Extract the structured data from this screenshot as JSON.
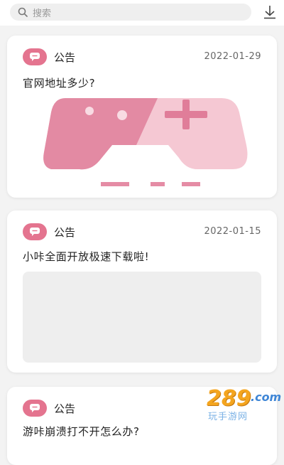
{
  "search": {
    "placeholder": "搜索",
    "icon": "search-icon"
  },
  "header": {
    "download_icon": "download-icon"
  },
  "colors": {
    "accent": "#e4748f",
    "image_pink": "#e8a1b4",
    "image_light": "#f4c6d2"
  },
  "notices": [
    {
      "badge": "公告",
      "date": "2022-01-29",
      "title": "官网地址多少?"
    },
    {
      "badge": "公告",
      "date": "2022-01-15",
      "title": "小咔全面开放极速下载啦!"
    },
    {
      "badge": "公告",
      "date": "",
      "title": "游咔崩溃打不开怎么办?"
    }
  ],
  "watermark": {
    "brand": "289",
    "domain": ".com",
    "subtitle": "玩手游网"
  }
}
